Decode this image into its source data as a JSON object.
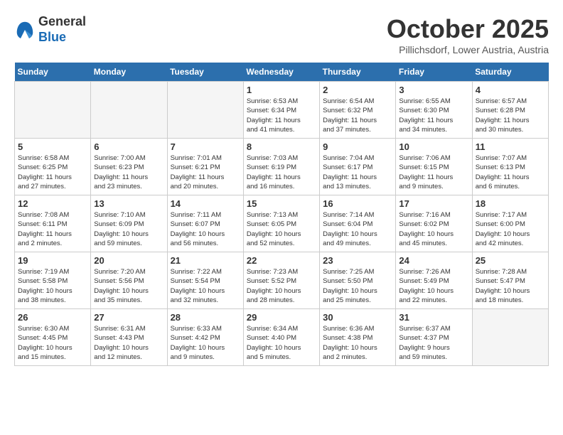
{
  "header": {
    "logo_line1": "General",
    "logo_line2": "Blue",
    "month": "October 2025",
    "location": "Pillichsdorf, Lower Austria, Austria"
  },
  "days_of_week": [
    "Sunday",
    "Monday",
    "Tuesday",
    "Wednesday",
    "Thursday",
    "Friday",
    "Saturday"
  ],
  "weeks": [
    [
      {
        "day": "",
        "info": ""
      },
      {
        "day": "",
        "info": ""
      },
      {
        "day": "",
        "info": ""
      },
      {
        "day": "1",
        "info": "Sunrise: 6:53 AM\nSunset: 6:34 PM\nDaylight: 11 hours\nand 41 minutes."
      },
      {
        "day": "2",
        "info": "Sunrise: 6:54 AM\nSunset: 6:32 PM\nDaylight: 11 hours\nand 37 minutes."
      },
      {
        "day": "3",
        "info": "Sunrise: 6:55 AM\nSunset: 6:30 PM\nDaylight: 11 hours\nand 34 minutes."
      },
      {
        "day": "4",
        "info": "Sunrise: 6:57 AM\nSunset: 6:28 PM\nDaylight: 11 hours\nand 30 minutes."
      }
    ],
    [
      {
        "day": "5",
        "info": "Sunrise: 6:58 AM\nSunset: 6:25 PM\nDaylight: 11 hours\nand 27 minutes."
      },
      {
        "day": "6",
        "info": "Sunrise: 7:00 AM\nSunset: 6:23 PM\nDaylight: 11 hours\nand 23 minutes."
      },
      {
        "day": "7",
        "info": "Sunrise: 7:01 AM\nSunset: 6:21 PM\nDaylight: 11 hours\nand 20 minutes."
      },
      {
        "day": "8",
        "info": "Sunrise: 7:03 AM\nSunset: 6:19 PM\nDaylight: 11 hours\nand 16 minutes."
      },
      {
        "day": "9",
        "info": "Sunrise: 7:04 AM\nSunset: 6:17 PM\nDaylight: 11 hours\nand 13 minutes."
      },
      {
        "day": "10",
        "info": "Sunrise: 7:06 AM\nSunset: 6:15 PM\nDaylight: 11 hours\nand 9 minutes."
      },
      {
        "day": "11",
        "info": "Sunrise: 7:07 AM\nSunset: 6:13 PM\nDaylight: 11 hours\nand 6 minutes."
      }
    ],
    [
      {
        "day": "12",
        "info": "Sunrise: 7:08 AM\nSunset: 6:11 PM\nDaylight: 11 hours\nand 2 minutes."
      },
      {
        "day": "13",
        "info": "Sunrise: 7:10 AM\nSunset: 6:09 PM\nDaylight: 10 hours\nand 59 minutes."
      },
      {
        "day": "14",
        "info": "Sunrise: 7:11 AM\nSunset: 6:07 PM\nDaylight: 10 hours\nand 56 minutes."
      },
      {
        "day": "15",
        "info": "Sunrise: 7:13 AM\nSunset: 6:05 PM\nDaylight: 10 hours\nand 52 minutes."
      },
      {
        "day": "16",
        "info": "Sunrise: 7:14 AM\nSunset: 6:04 PM\nDaylight: 10 hours\nand 49 minutes."
      },
      {
        "day": "17",
        "info": "Sunrise: 7:16 AM\nSunset: 6:02 PM\nDaylight: 10 hours\nand 45 minutes."
      },
      {
        "day": "18",
        "info": "Sunrise: 7:17 AM\nSunset: 6:00 PM\nDaylight: 10 hours\nand 42 minutes."
      }
    ],
    [
      {
        "day": "19",
        "info": "Sunrise: 7:19 AM\nSunset: 5:58 PM\nDaylight: 10 hours\nand 38 minutes."
      },
      {
        "day": "20",
        "info": "Sunrise: 7:20 AM\nSunset: 5:56 PM\nDaylight: 10 hours\nand 35 minutes."
      },
      {
        "day": "21",
        "info": "Sunrise: 7:22 AM\nSunset: 5:54 PM\nDaylight: 10 hours\nand 32 minutes."
      },
      {
        "day": "22",
        "info": "Sunrise: 7:23 AM\nSunset: 5:52 PM\nDaylight: 10 hours\nand 28 minutes."
      },
      {
        "day": "23",
        "info": "Sunrise: 7:25 AM\nSunset: 5:50 PM\nDaylight: 10 hours\nand 25 minutes."
      },
      {
        "day": "24",
        "info": "Sunrise: 7:26 AM\nSunset: 5:49 PM\nDaylight: 10 hours\nand 22 minutes."
      },
      {
        "day": "25",
        "info": "Sunrise: 7:28 AM\nSunset: 5:47 PM\nDaylight: 10 hours\nand 18 minutes."
      }
    ],
    [
      {
        "day": "26",
        "info": "Sunrise: 6:30 AM\nSunset: 4:45 PM\nDaylight: 10 hours\nand 15 minutes."
      },
      {
        "day": "27",
        "info": "Sunrise: 6:31 AM\nSunset: 4:43 PM\nDaylight: 10 hours\nand 12 minutes."
      },
      {
        "day": "28",
        "info": "Sunrise: 6:33 AM\nSunset: 4:42 PM\nDaylight: 10 hours\nand 9 minutes."
      },
      {
        "day": "29",
        "info": "Sunrise: 6:34 AM\nSunset: 4:40 PM\nDaylight: 10 hours\nand 5 minutes."
      },
      {
        "day": "30",
        "info": "Sunrise: 6:36 AM\nSunset: 4:38 PM\nDaylight: 10 hours\nand 2 minutes."
      },
      {
        "day": "31",
        "info": "Sunrise: 6:37 AM\nSunset: 4:37 PM\nDaylight: 9 hours\nand 59 minutes."
      },
      {
        "day": "",
        "info": ""
      }
    ]
  ]
}
